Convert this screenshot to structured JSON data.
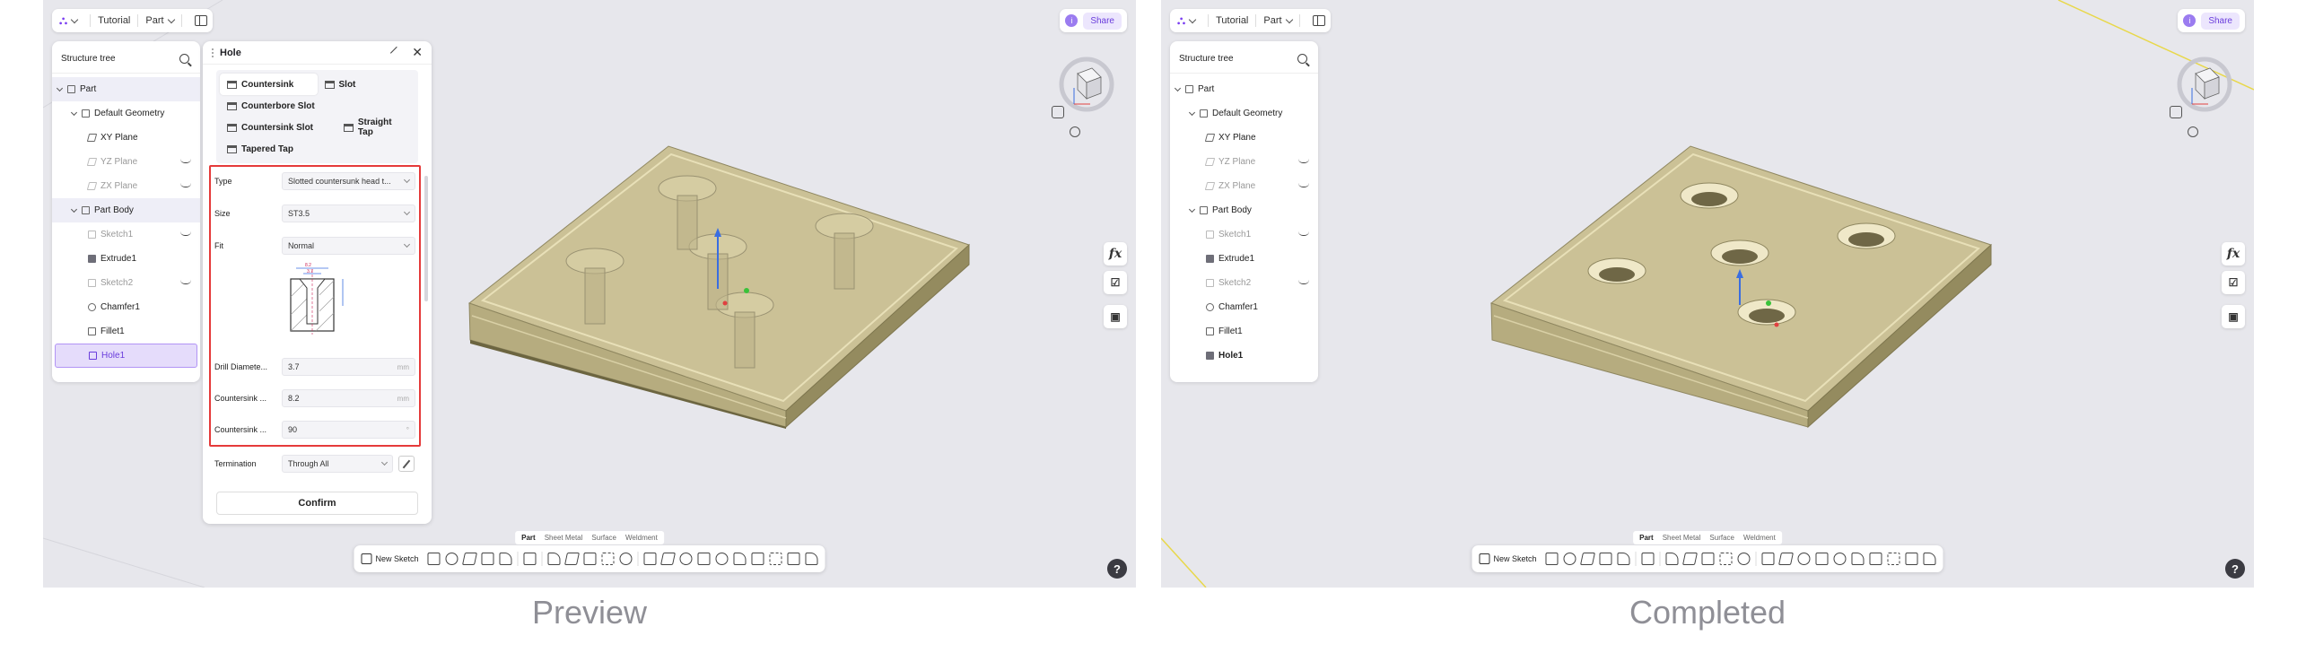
{
  "topbar": {
    "breadcrumb_file": "Tutorial",
    "breadcrumb_mode": "Part"
  },
  "share": {
    "info": "i",
    "label": "Share"
  },
  "tree": {
    "title": "Structure tree",
    "items": [
      {
        "label": "Part",
        "icon": "part-icon"
      },
      {
        "label": "Default Geometry",
        "icon": "geometry-icon"
      },
      {
        "label": "XY Plane",
        "icon": "plane-icon"
      },
      {
        "label": "YZ Plane",
        "icon": "plane-icon",
        "hidden": true
      },
      {
        "label": "ZX Plane",
        "icon": "plane-icon",
        "hidden": true
      },
      {
        "label": "Part Body",
        "icon": "body-icon"
      },
      {
        "label": "Sketch1",
        "icon": "sketch-icon",
        "hidden": true
      },
      {
        "label": "Extrude1",
        "icon": "extrude-icon"
      },
      {
        "label": "Sketch2",
        "icon": "sketch-icon",
        "hidden": true
      },
      {
        "label": "Chamfer1",
        "icon": "chamfer-icon"
      },
      {
        "label": "Fillet1",
        "icon": "fillet-icon"
      },
      {
        "label": "Hole1",
        "icon": "hole-icon"
      }
    ]
  },
  "hole_panel": {
    "title": "Hole",
    "types": [
      "Countersink",
      "Slot",
      "Counterbore Slot",
      "Countersink Slot",
      "Straight Tap",
      "Tapered Tap"
    ],
    "type_label": "Type",
    "type_value": "Slotted countersunk head t...",
    "size_label": "Size",
    "size_value": "ST3.5",
    "fit_label": "Fit",
    "fit_value": "Normal",
    "diagram_dims": [
      "8.2",
      "3.7"
    ],
    "drill_label": "Drill Diamete...",
    "drill_value": "3.7",
    "drill_unit": "mm",
    "cs_dia_label": "Countersink ...",
    "cs_dia_value": "8.2",
    "cs_dia_unit": "mm",
    "cs_angle_label": "Countersink ...",
    "cs_angle_value": "90",
    "cs_angle_unit": "°",
    "termination_label": "Termination",
    "termination_value": "Through All",
    "confirm_label": "Confirm"
  },
  "side_tools": {
    "fx": "fx"
  },
  "help": "?",
  "mode_tabs": [
    "Part",
    "Sheet Metal",
    "Surface",
    "Weldment"
  ],
  "toolbar": {
    "new_sketch": "New Sketch"
  },
  "captions": {
    "left": "Preview",
    "right": "Completed"
  },
  "colors": {
    "accent": "#7b3ff2",
    "highlight_border": "#e53a3a",
    "plate_top": "#cbc196",
    "viewport_bg": "#e7e7ec"
  }
}
